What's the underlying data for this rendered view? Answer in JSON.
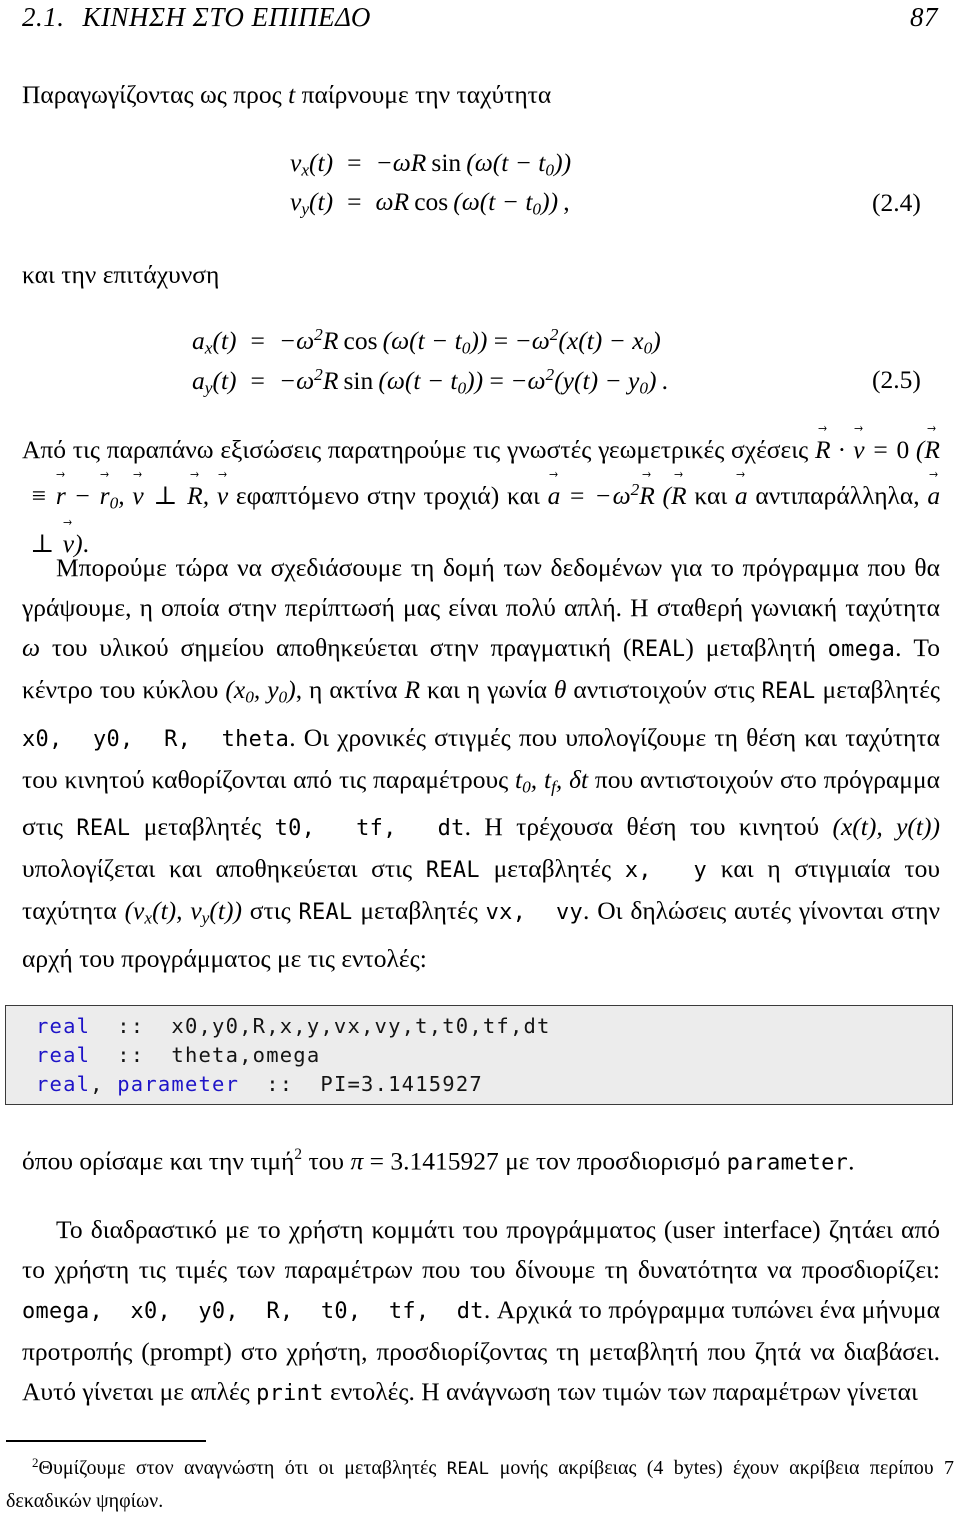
{
  "page": {
    "number": "87",
    "section_number": "2.1.",
    "running_head": "ΚΙΝΗΣΗ ΣΤΟ ΕΠΙΠΕΔΟ"
  },
  "intro": {
    "line": "Παραγωγίζοντας ως προς t παίρνουμε την ταχύτητα"
  },
  "equation_24": {
    "tag": "(2.4)",
    "rows": [
      {
        "lhs": "v_x(t)",
        "rel": "=",
        "rhs": "-ωR sin (ω(t - t_0))"
      },
      {
        "lhs": "v_y(t)",
        "rel": "=",
        "rhs": "ωR cos (ω(t - t_0)) ,"
      }
    ]
  },
  "accel_lead": {
    "text": "και την επιτάχυνση"
  },
  "equation_25": {
    "tag": "(2.5)",
    "rows": [
      {
        "lhs": "a_x(t)",
        "rel": "=",
        "rhs": "-ω²R cos (ω(t - t_0)) = -ω²(x(t) - x_0)"
      },
      {
        "lhs": "a_y(t)",
        "rel": "=",
        "rhs": "-ω²R sin (ω(t - t_0)) = -ω²(y(t) - y_0)."
      }
    ]
  },
  "paragraphs": {
    "p1_part1": "Από τις παραπάνω εξισώσεις παρατηρούμε τις γνωστές γεωμετρικές σχέσεις ",
    "p1_part2": " εφαπτόμενο στην τροχιά) και ",
    "p1_part3": " αντιπαράλληλα, ",
    "p2": "Μπορούμε τώρα να σχεδιάσουμε τη δομή των δεδομένων για το πρόγραμμα που θα γράψουμε, η οποία στην περίπτωσή μας είναι πολύ απλή. Η σταθερή γωνιακή ταχύτητα ω του υλικού σημείου αποθηκεύεται στην πραγματική (REAL) μεταβλητή omega. Το κέντρο του κύκλου (x₀, y₀), η ακτίνα R και η γωνία θ αντιστοιχούν στις REAL μεταβλητές x0, y0, R, theta. Οι χρονικές στιγμές που υπολογίζουμε τη θέση και ταχύτητα του κινητού καθορίζονται από τις παραμέτρους t₀, t_f, δt που αντιστοιχούν στο πρόγραμμα στις REAL μεταβλητές t0, tf, dt. Η τρέχουσα θέση του κινητού (x(t), y(t)) υπολογίζεται και αποθηκεύεται στις REAL μεταβλητές x, y και η στιγμιαία του ταχύτητα (v_x(t), v_y(t)) στις REAL μεταβλητές vx, vy. Οι δηλώσεις αυτές γίνονται στην αρχή του προγράμματος με τις εντολές:",
    "p3_pre": "όπου ορίσαμε και την τιμή",
    "p3_mid": "του π = 3.1415927 με τον προσδιορισμό parameter.",
    "p4": "Το διαδραστικό με το χρήστη κομμάτι του προγράμματος (user interface) ζητάει από το χρήστη τις τιμές των παραμέτρων που του δίνουμε τη δυνατότητα να προσδιορίζει: omega, x0, y0, R, t0, tf, dt. Αρχικά το πρόγραμμα τυπώνει ένα μήνυμα προτροπής (prompt) στο χρήστη, προσδιορίζοντας τη μεταβλητή που ζητά να διαβάσει. Αυτό γίνεται με απλές print εντολές. Η ανάγνωση των τιμών των παραμέτρων γίνεται"
  },
  "code_listing": {
    "background": "#ececec",
    "keyword_color": "#1e14c8",
    "lines": [
      {
        "keyword": "real",
        "rest": "  ::  x0,y0,R,x,y,vx,vy,t,t0,tf,dt"
      },
      {
        "keyword": "real",
        "rest": "  ::  theta,omega"
      },
      {
        "keyword2": "real, parameter",
        "rest2": "  ::  PI=3.1415927"
      }
    ],
    "line1_kw": "real",
    "line1_rest": "  ::  x0,y0,R,x,y,vx,vy,t,t0,tf,dt",
    "line2_kw": "real",
    "line2_rest": "  ::  theta,omega",
    "line3_kw_a": "real",
    "line3_comma": ", ",
    "line3_kw_b": "parameter",
    "line3_rest": "  ::  PI=3.1415927"
  },
  "footnote": {
    "marker": "2",
    "text": "Θυμίζουμε στον αναγνώστη ότι οι μεταβλητές REAL μονής ακρίβειας (4 bytes) έχουν ακρίβεια περίπου 7 δεκαδικών ψηφίων."
  }
}
